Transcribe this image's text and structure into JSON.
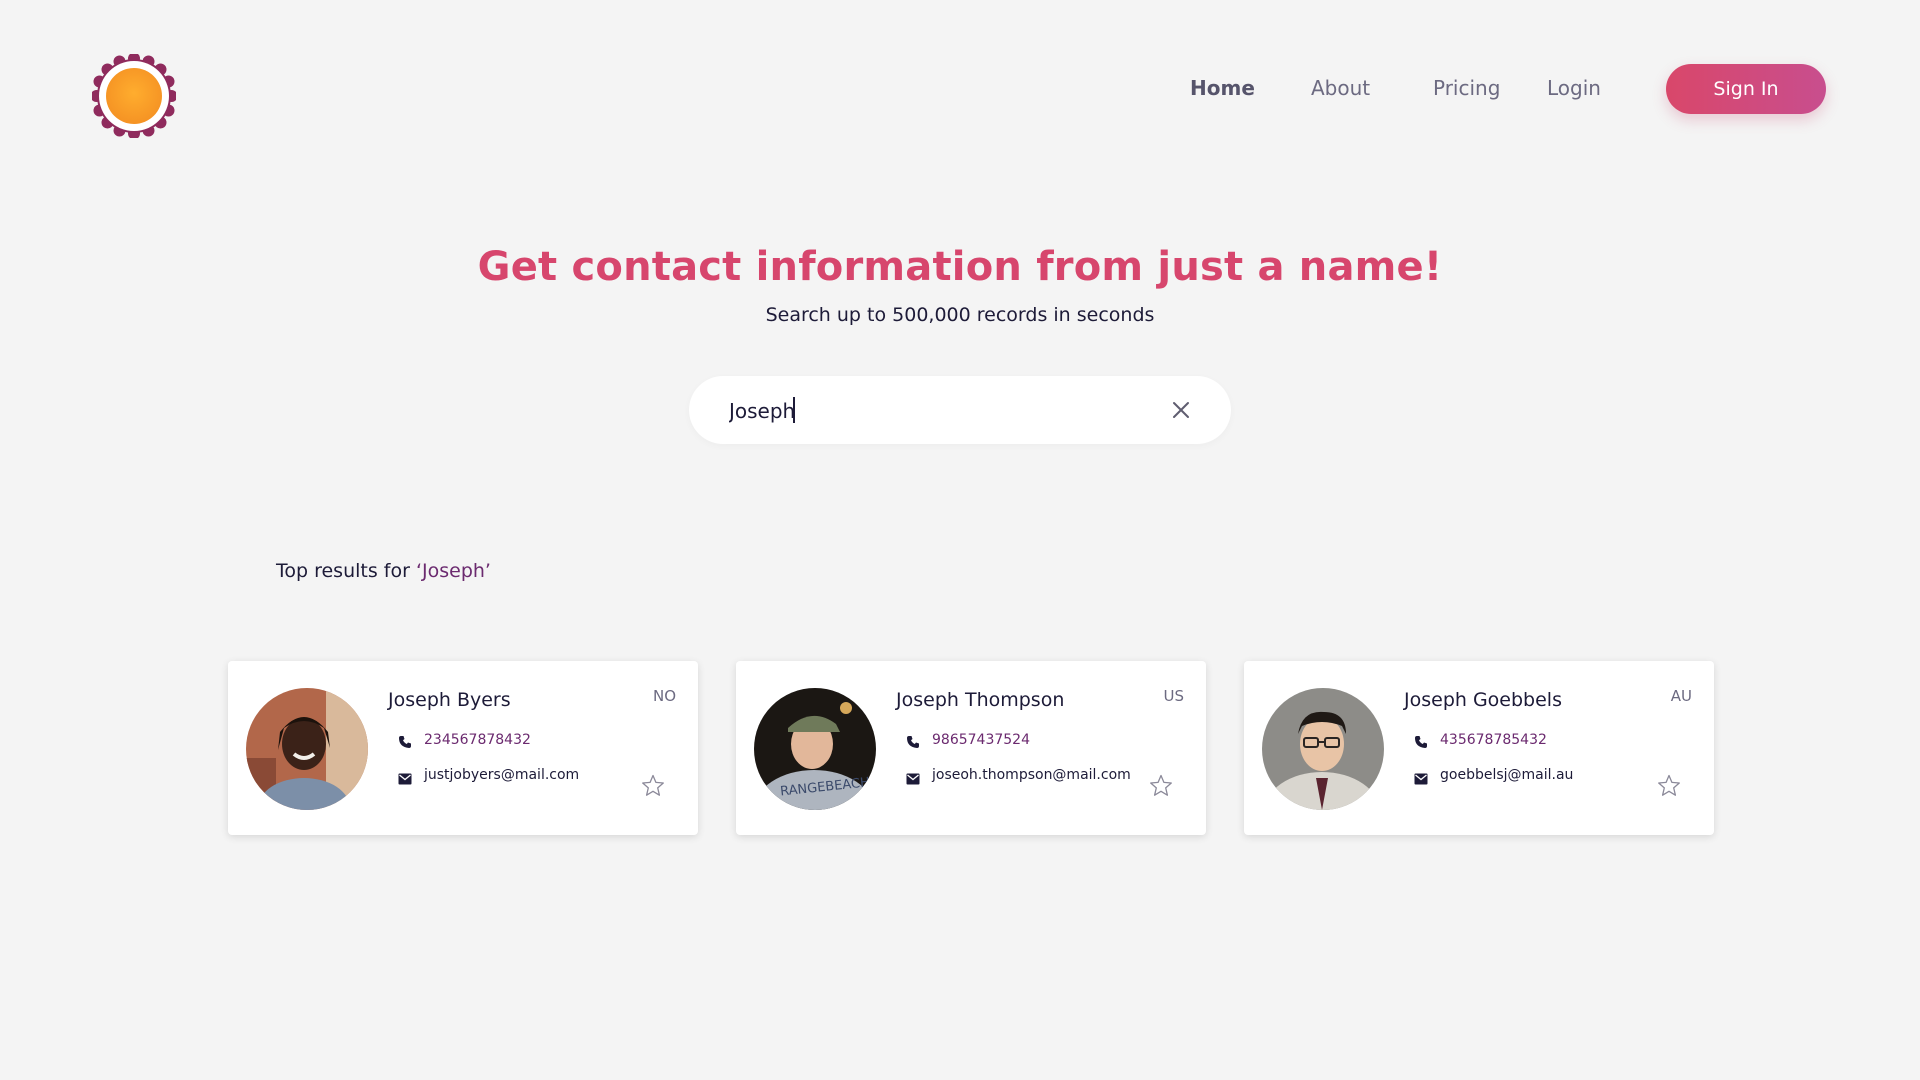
{
  "nav": {
    "home": "Home",
    "about": "About",
    "pricing": "Pricing",
    "login": "Login",
    "sign_in": "Sign In"
  },
  "hero": {
    "title": "Get contact information from just a name!",
    "subtitle": "Search up to 500,000 records in seconds"
  },
  "search": {
    "value": "Joseph",
    "placeholder": ""
  },
  "results": {
    "heading_prefix": "Top results for ",
    "heading_query": "‘Joseph’",
    "cards": [
      {
        "name": "Joseph Byers",
        "country": "NO",
        "phone": "234567878432",
        "email": "justjobyers@mail.com"
      },
      {
        "name": "Joseph Thompson",
        "country": "US",
        "phone": "98657437524",
        "email": "joseoh.thompson@mail.com"
      },
      {
        "name": "Joseph Goebbels",
        "country": "AU",
        "phone": "435678785432",
        "email": "goebbelsj@mail.au"
      }
    ]
  },
  "colors": {
    "accent": "#d7466d",
    "accent_purple": "#6b2a6f",
    "logo_orange": "#f7a329",
    "background": "#f4f4f4"
  },
  "icons": {
    "logo": "sun-flower-logo-icon",
    "clear": "close-icon",
    "phone": "phone-icon",
    "email": "envelope-icon",
    "favorite": "star-outline-icon"
  }
}
